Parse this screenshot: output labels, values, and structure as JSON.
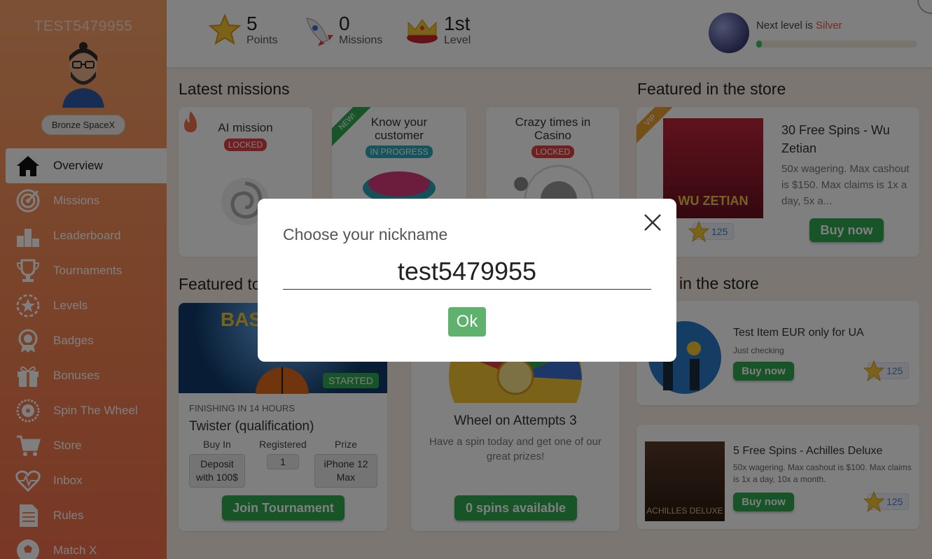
{
  "sidebar": {
    "username": "TEST5479955",
    "rank": "Bronze SpaceX",
    "items": [
      {
        "label": "Overview",
        "icon": "home-icon",
        "active": true
      },
      {
        "label": "Missions",
        "icon": "target-icon"
      },
      {
        "label": "Leaderboard",
        "icon": "podium-icon"
      },
      {
        "label": "Tournaments",
        "icon": "trophy-icon"
      },
      {
        "label": "Levels",
        "icon": "star-badge-icon"
      },
      {
        "label": "Badges",
        "icon": "medal-icon"
      },
      {
        "label": "Bonuses",
        "icon": "gift-icon"
      },
      {
        "label": "Spin The Wheel",
        "icon": "wheel-icon"
      },
      {
        "label": "Store",
        "icon": "cart-icon"
      },
      {
        "label": "Inbox",
        "icon": "heart-pulse-icon"
      },
      {
        "label": "Rules",
        "icon": "document-icon"
      },
      {
        "label": "Match X",
        "icon": "soccer-ball-icon"
      }
    ]
  },
  "topbar": {
    "points": {
      "value": "5",
      "label": "Points"
    },
    "missions": {
      "value": "0",
      "label": "Missions"
    },
    "level": {
      "value": "1st",
      "label": "Level"
    },
    "next_level_prefix": "Next level is",
    "next_level_name": "Silver",
    "next_level_progress": 0.03
  },
  "missions": {
    "title": "Latest missions",
    "cards": [
      {
        "title": "AI mission",
        "status": "LOCKED"
      },
      {
        "title": "Know your customer",
        "status": "IN PROGRESS",
        "ribbon": "NEW!"
      },
      {
        "title": "Crazy times in Casino",
        "status": "LOCKED"
      }
    ]
  },
  "store_featured": {
    "title": "Featured in the store",
    "item": {
      "ribbon": "VIP",
      "image_text": "WU ZETIAN",
      "name": "30 Free Spins - Wu Zetian",
      "desc": "50x wagering. Max cashout is $150. Max claims is 1x a day, 5x a...",
      "price": "125",
      "buy_label": "Buy now"
    }
  },
  "tournaments": {
    "title": "Featured to",
    "card": {
      "banner_text": "BAS TOU",
      "status": "STARTED",
      "finishing": "FINISHING IN 14 HOURS",
      "name": "Twister (qualification)",
      "cols": [
        {
          "header": "Buy In",
          "value": "Deposit with 100$"
        },
        {
          "header": "Registered",
          "value": "1"
        },
        {
          "header": "Prize",
          "value": "iPhone 12 Max"
        }
      ],
      "join_label": "Join Tournament"
    }
  },
  "wheel": {
    "title": "Wheel on Attempts 3",
    "desc": "Have a spin today and get one of our great prizes!",
    "spins_label": "0 spins available"
  },
  "store_list": {
    "title": "in the store",
    "items": [
      {
        "name": "Test Item EUR only for UA",
        "desc": "Just checking",
        "price": "125",
        "buy_label": "Buy now"
      },
      {
        "name": "5 Free Spins - Achilles Deluxe",
        "desc": "50x wagering. Max cashout is $100. Max claims is 1x a day, 10x a month.",
        "image_text": "ACHILLES DELUXE",
        "price": "125",
        "buy_label": "Buy now"
      }
    ]
  },
  "modal": {
    "title": "Choose your nickname",
    "input_value": "test5479955",
    "ok_label": "Ok"
  },
  "colors": {
    "sidebar_top": "#f7a36a",
    "sidebar_bottom": "#f0704a",
    "accent_green": "#2fa84f",
    "locked_red": "#e04040",
    "progress_teal": "#2ba8b8"
  }
}
